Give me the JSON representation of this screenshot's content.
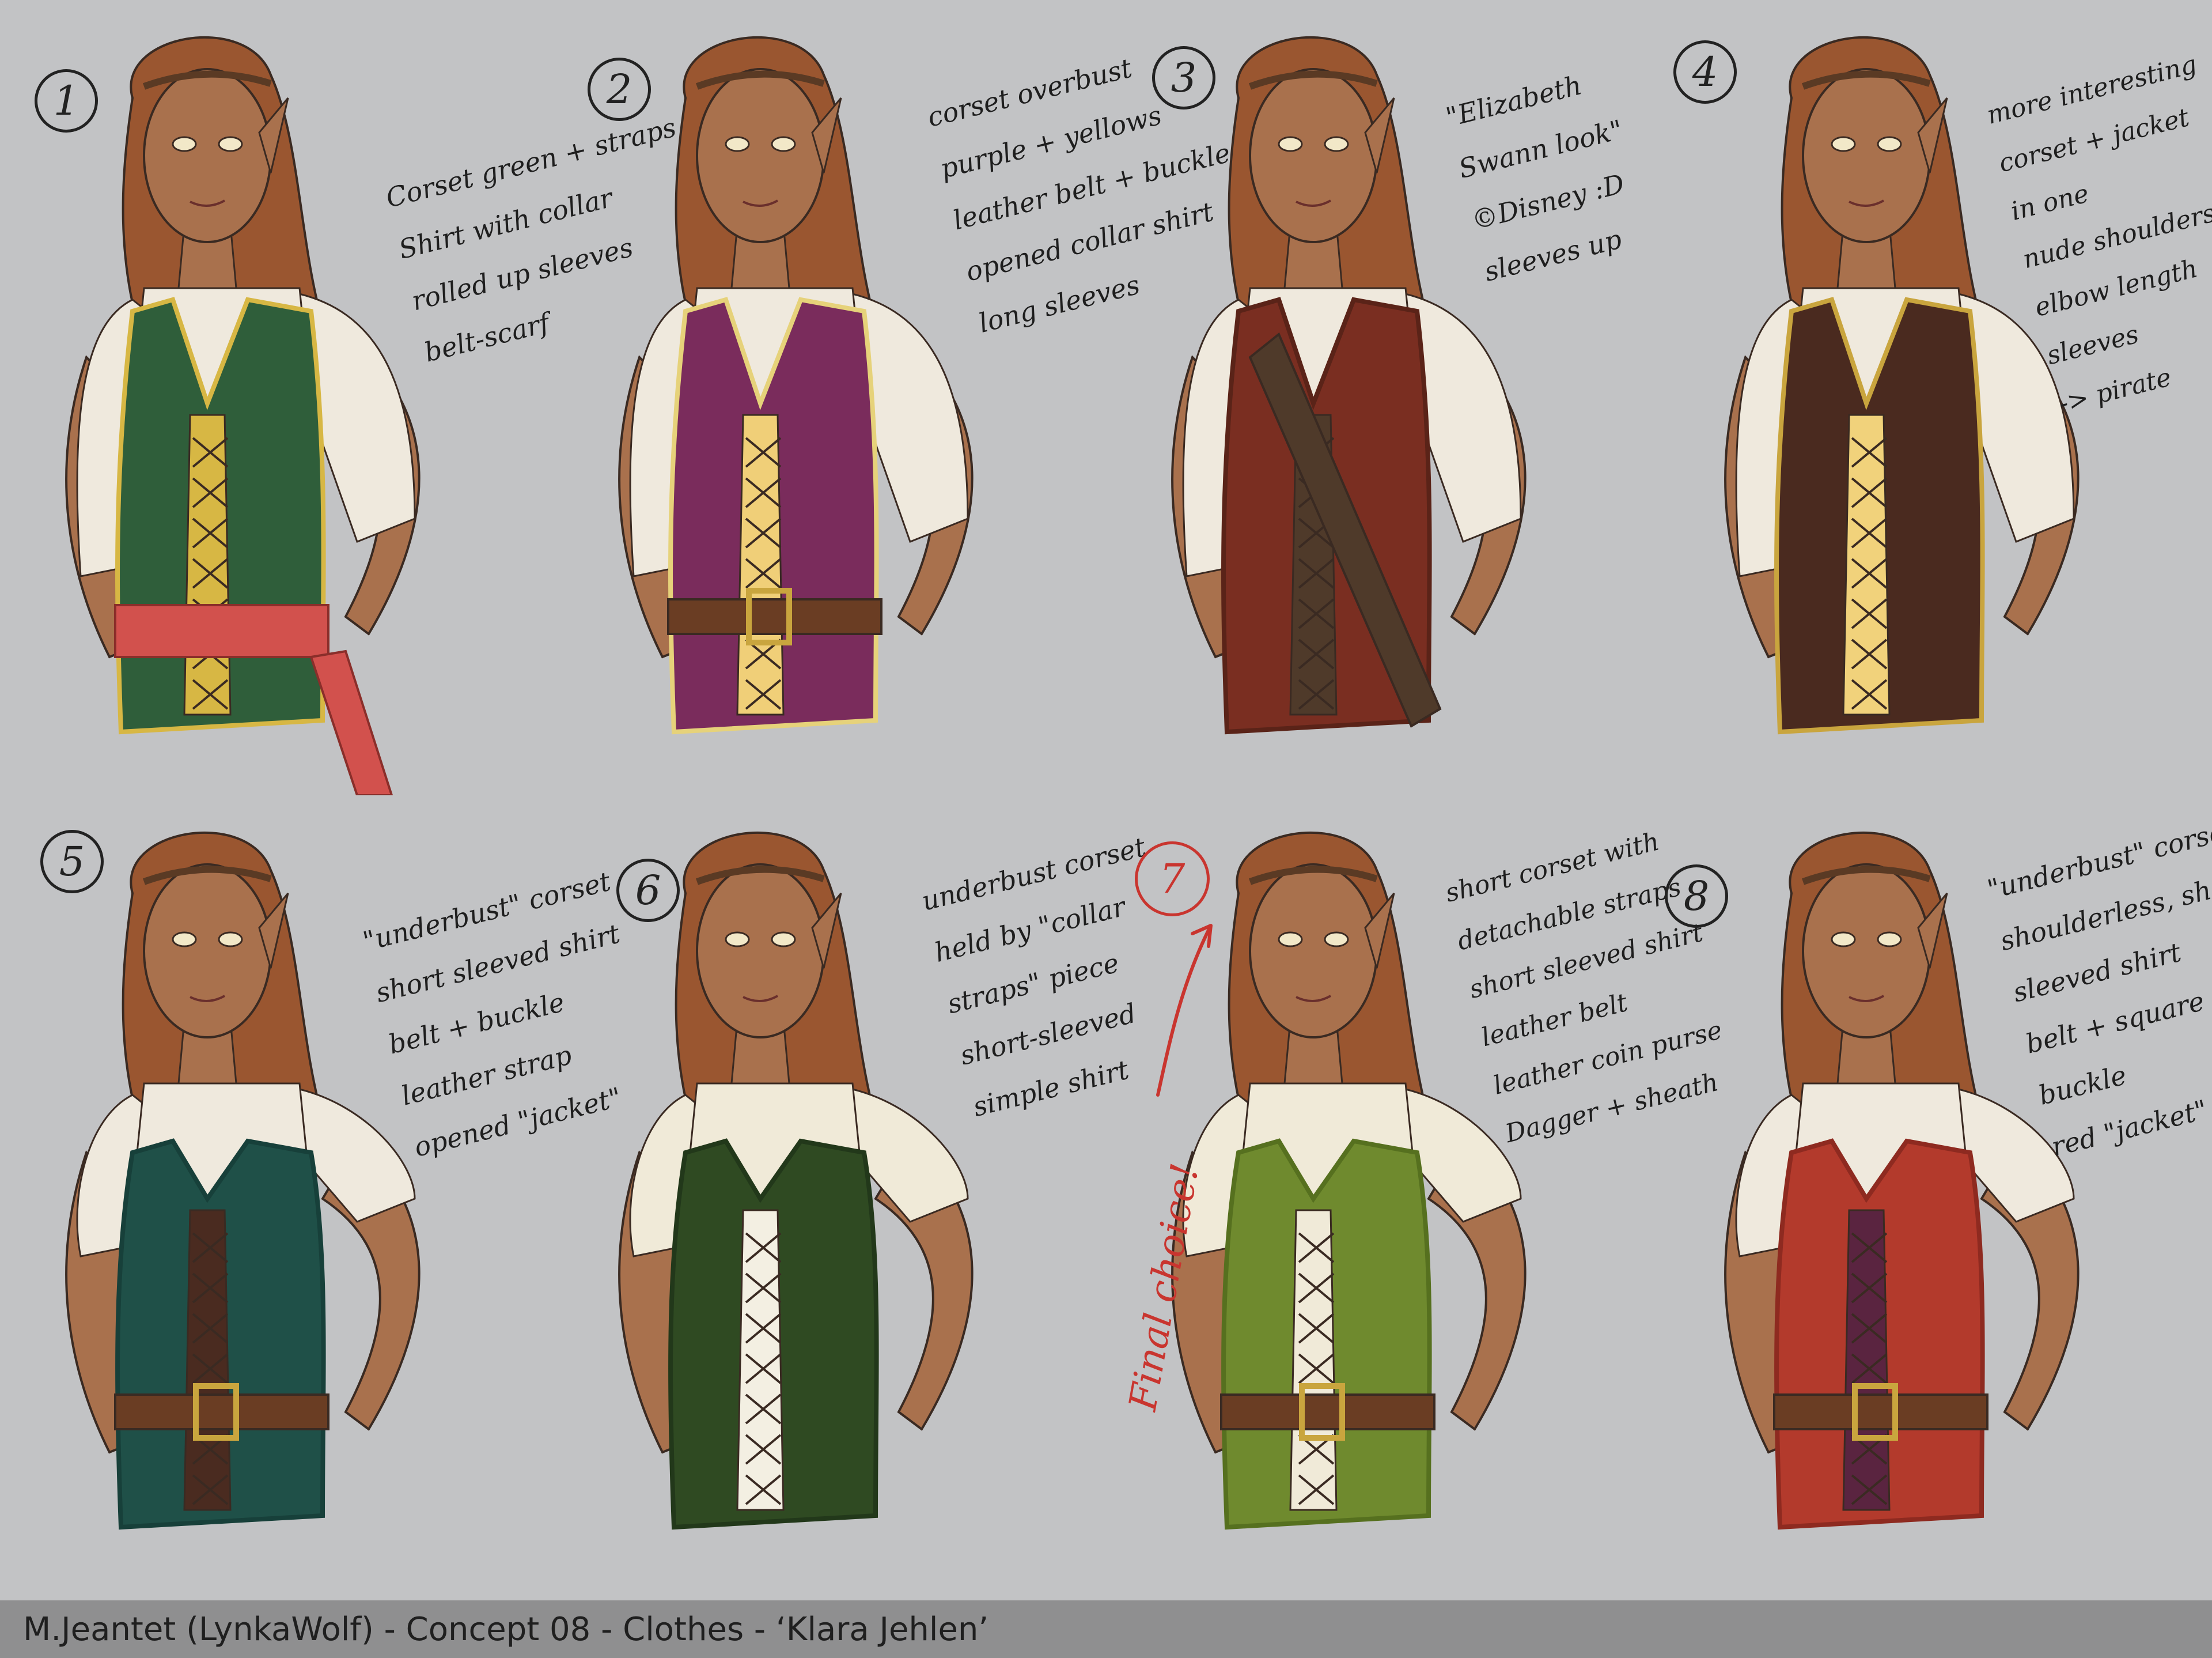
{
  "panels": [
    {
      "number": "1",
      "notes": [
        "Corset green + straps",
        "Shirt with collar",
        "rolled up sleeves",
        "belt-scarf"
      ],
      "colors": {
        "vest": "#2f5e3a",
        "trim": "#d7b744",
        "accent": "#d7b744",
        "sash": "#d2514d",
        "shirt": "#efe9dd"
      }
    },
    {
      "number": "2",
      "notes": [
        "corset overbust",
        "purple + yellows",
        "leather belt + buckle",
        "opened collar shirt",
        "long sleeves"
      ],
      "colors": {
        "vest": "#7a2c5c",
        "trim": "#e6d27a",
        "accent": "#f0cf78",
        "belt": "#6a3d23",
        "shirt": "#efe9dd"
      }
    },
    {
      "number": "3",
      "notes": [
        "\"Elizabeth",
        "Swann look\"",
        "©Disney :D",
        "sleeves up"
      ],
      "colors": {
        "vest": "#7a2e21",
        "trim": "#5a2318",
        "accent": "#4f3a2a",
        "strap": "#4f3a2a",
        "shirt": "#efe9dd"
      }
    },
    {
      "number": "4",
      "notes": [
        "more interesting",
        "corset + jacket",
        "in one",
        "nude shoulders",
        "elbow length",
        "sleeves",
        "-> pirate"
      ],
      "colors": {
        "vest": "#4a2a1f",
        "trim": "#c9a53e",
        "accent": "#f1d27b",
        "shirt": "#efe9dd"
      }
    },
    {
      "number": "5",
      "notes": [
        "\"underbust\" corset",
        "short sleeved shirt",
        "belt + buckle",
        "leather strap",
        "opened \"jacket\""
      ],
      "colors": {
        "vest": "#1f5048",
        "trim": "#17403a",
        "accent": "#4a2b20",
        "belt": "#6a3d23",
        "shirt": "#efe9dd"
      }
    },
    {
      "number": "6",
      "notes": [
        "underbust corset",
        "held by \"collar",
        "straps\" piece",
        "short-sleeved",
        "simple shirt"
      ],
      "colors": {
        "vest": "#2f4a22",
        "trim": "#22381a",
        "accent": "#f3efe2",
        "shirt": "#f0ead8"
      }
    },
    {
      "number": "7",
      "notes": [
        "short corset with",
        "detachable straps",
        "short sleeved shirt",
        "leather belt",
        "leather coin purse",
        "Dagger + sheath"
      ],
      "colors": {
        "vest": "#6f8a2e",
        "trim": "#56701f",
        "accent": "#f0ead8",
        "belt": "#6a3d23",
        "shirt": "#f0ead8"
      }
    },
    {
      "number": "8",
      "notes": [
        "\"underbust\" corset",
        "shoulderless, short",
        "sleeved shirt",
        "belt + square",
        "buckle",
        "red \"jacket\""
      ],
      "colors": {
        "vest": "#b33a2c",
        "trim": "#8e2a20",
        "accent": "#5a2440",
        "belt": "#6a3d23",
        "shirt": "#efe9dd"
      }
    }
  ],
  "final_choice": "Final choice!",
  "footer": {
    "credit": "M.Jeantet (LynkaWolf) - Concept 08 - Clothes - ‘Klara Jehlen’"
  }
}
